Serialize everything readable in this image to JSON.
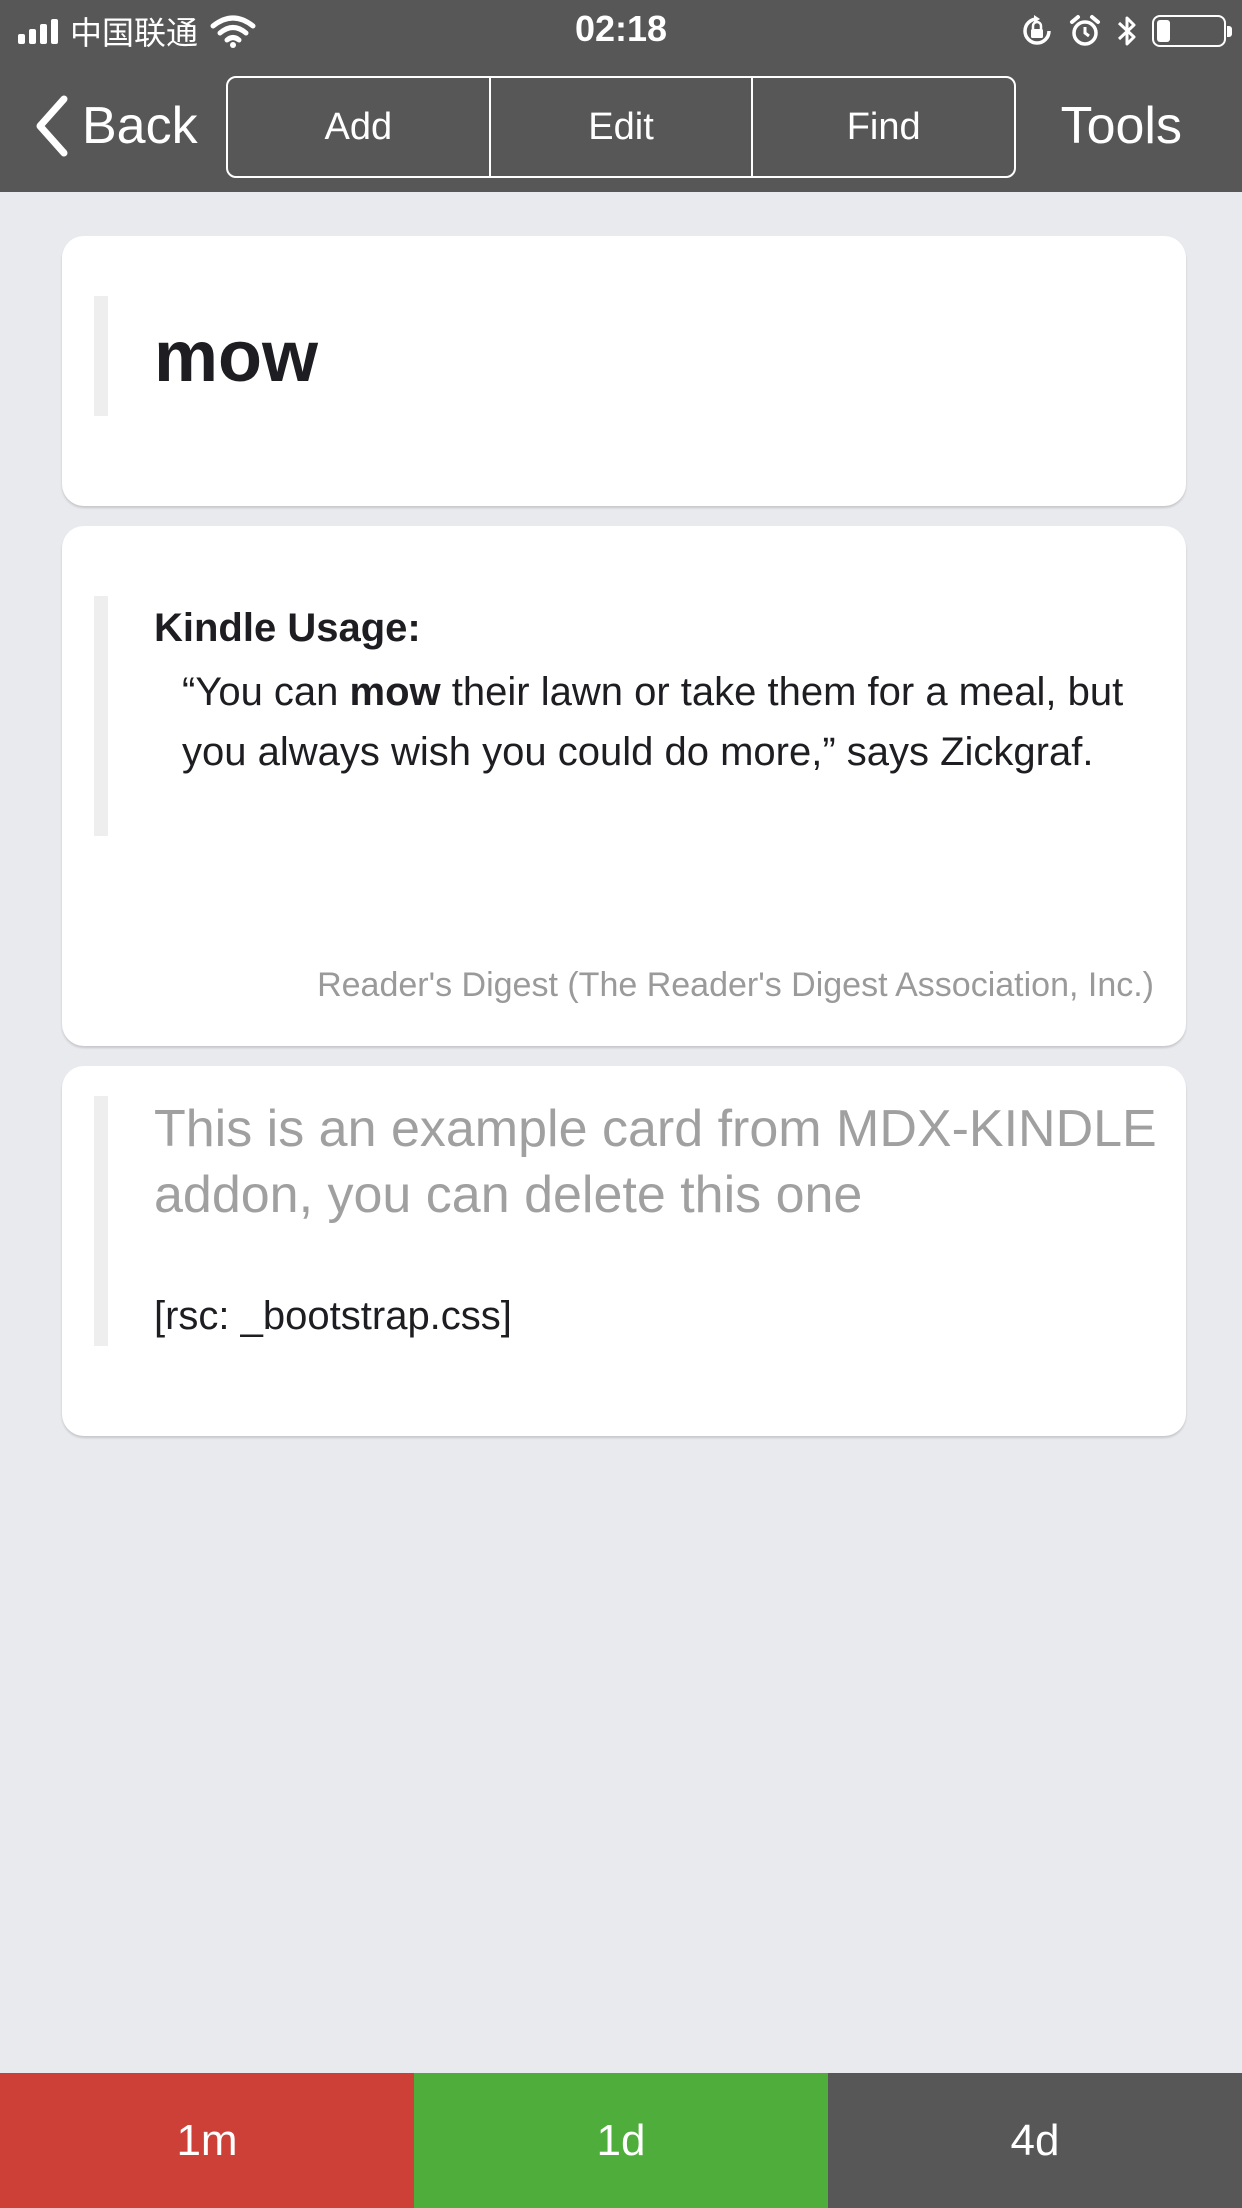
{
  "status_bar": {
    "carrier": "中国联通",
    "time": "02:18",
    "battery_level": 0.2
  },
  "nav": {
    "back_label": "Back",
    "segments": [
      "Add",
      "Edit",
      "Find"
    ],
    "tools_label": "Tools"
  },
  "card_word": {
    "word": "mow"
  },
  "card_usage": {
    "heading": "Kindle Usage:",
    "quote_before": "“You can ",
    "quote_bold": "mow",
    "quote_after": " their lawn or take them for a meal, but you always wish you could do more,” says Zickgraf.",
    "source": "Reader's Digest (The Reader's Digest Association, Inc.)"
  },
  "card_example": {
    "note": "This is an example card from MDX-KINDLE addon, you can delete this one",
    "resource": "[rsc: _bootstrap.css]"
  },
  "answers": [
    {
      "label": "1m",
      "color": "#cc4037"
    },
    {
      "label": "1d",
      "color": "#4fad3c"
    },
    {
      "label": "4d",
      "color": "#575757"
    }
  ],
  "colors": {
    "bar_background": "#575757",
    "page_background": "#e9eaee"
  },
  "icons": {
    "back": "chevron-left-icon",
    "wifi": "wifi-icon",
    "rotation_lock": "rotation-lock-icon",
    "alarm": "alarm-icon",
    "bluetooth": "bluetooth-icon",
    "battery": "battery-icon"
  }
}
